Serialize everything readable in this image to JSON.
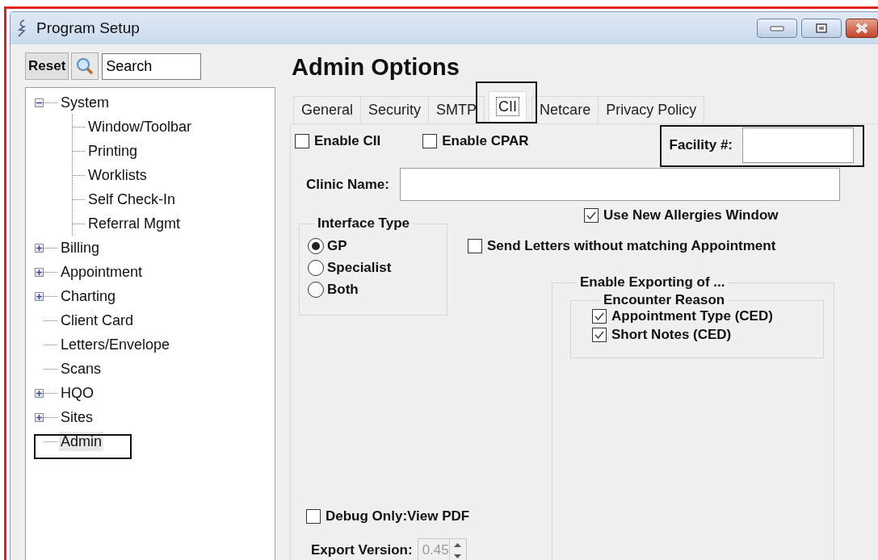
{
  "window": {
    "title": "Program Setup"
  },
  "sidebar": {
    "reset_button": "Reset",
    "search": {
      "value": "Search"
    },
    "tree": [
      {
        "label": "System",
        "expanded": true,
        "selected": false,
        "children": [
          {
            "label": "Window/Toolbar",
            "selected": false
          },
          {
            "label": "Printing",
            "selected": false
          },
          {
            "label": "Worklists",
            "selected": false
          },
          {
            "label": "Self Check-In",
            "selected": false
          },
          {
            "label": "Referral Mgmt",
            "selected": false
          }
        ]
      },
      {
        "label": "Billing",
        "expanded": false,
        "selected": false
      },
      {
        "label": "Appointment",
        "expanded": false,
        "selected": false
      },
      {
        "label": "Charting",
        "expanded": false,
        "selected": false
      },
      {
        "label": "Client Card",
        "selected": false
      },
      {
        "label": "Letters/Envelope",
        "selected": false
      },
      {
        "label": "Scans",
        "selected": false
      },
      {
        "label": "HQO",
        "expanded": false,
        "selected": false
      },
      {
        "label": "Sites",
        "expanded": false,
        "selected": false
      },
      {
        "label": "Admin",
        "selected": true,
        "highlighted": true
      }
    ]
  },
  "heading": "Admin Options",
  "tabs": [
    {
      "label": "General",
      "selected": false
    },
    {
      "label": "Security",
      "selected": false
    },
    {
      "label": "SMTP",
      "selected": false
    },
    {
      "label": "CII",
      "selected": true,
      "highlighted": true
    },
    {
      "label": "Netcare",
      "selected": false
    },
    {
      "label": "Privacy Policy",
      "selected": false
    }
  ],
  "form": {
    "enable_cii": {
      "label": "Enable CII",
      "checked": false
    },
    "enable_cpar": {
      "label": "Enable CPAR",
      "checked": false
    },
    "facility": {
      "label": "Facility #:",
      "highlighted": true
    },
    "clinic_name": {
      "label": "Clinic Name:"
    },
    "interface_type": {
      "title": "Interface Type",
      "options": [
        {
          "label": "GP",
          "selected": true
        },
        {
          "label": "Specialist",
          "selected": false
        },
        {
          "label": "Both",
          "selected": false
        }
      ]
    },
    "use_new_allergies": {
      "label": "Use New Allergies Window",
      "checked": true
    },
    "send_letters": {
      "label": "Send Letters without matching Appointment",
      "checked": false
    },
    "export_group": {
      "title": "Enable Exporting of ...",
      "encounter_reason": {
        "title": "Encounter Reason",
        "items": [
          {
            "label": "Appointment Type (CED)",
            "checked": true
          },
          {
            "label": "Short Notes (CED)",
            "checked": true
          }
        ]
      }
    },
    "debug_pdf": {
      "label": "Debug Only:View PDF",
      "checked": false
    },
    "export_version": {
      "label": "Export Version:",
      "value": "0.45",
      "disabled": true
    }
  }
}
